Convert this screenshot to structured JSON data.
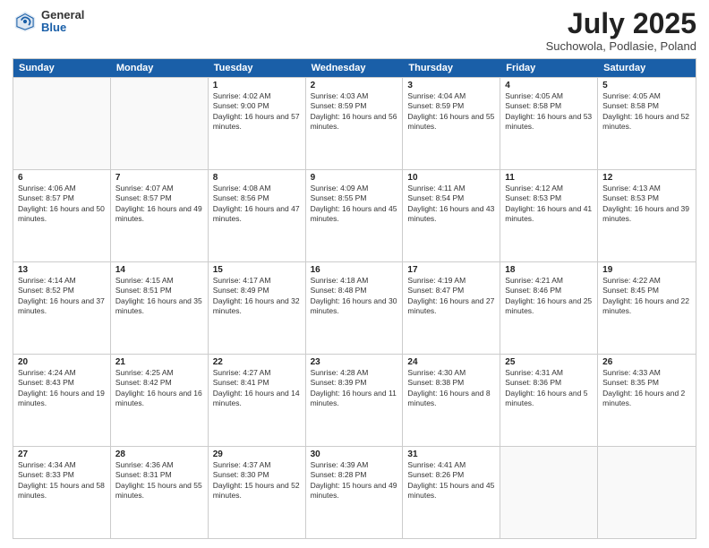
{
  "logo": {
    "general": "General",
    "blue": "Blue"
  },
  "header": {
    "month_year": "July 2025",
    "location": "Suchowola, Podlasie, Poland"
  },
  "days_of_week": [
    "Sunday",
    "Monday",
    "Tuesday",
    "Wednesday",
    "Thursday",
    "Friday",
    "Saturday"
  ],
  "weeks": [
    [
      {
        "day": "",
        "empty": true
      },
      {
        "day": "",
        "empty": true
      },
      {
        "day": "1",
        "rise": "4:02 AM",
        "set": "9:00 PM",
        "daylight": "16 hours and 57 minutes."
      },
      {
        "day": "2",
        "rise": "4:03 AM",
        "set": "8:59 PM",
        "daylight": "16 hours and 56 minutes."
      },
      {
        "day": "3",
        "rise": "4:04 AM",
        "set": "8:59 PM",
        "daylight": "16 hours and 55 minutes."
      },
      {
        "day": "4",
        "rise": "4:05 AM",
        "set": "8:58 PM",
        "daylight": "16 hours and 53 minutes."
      },
      {
        "day": "5",
        "rise": "4:05 AM",
        "set": "8:58 PM",
        "daylight": "16 hours and 52 minutes."
      }
    ],
    [
      {
        "day": "6",
        "rise": "4:06 AM",
        "set": "8:57 PM",
        "daylight": "16 hours and 50 minutes."
      },
      {
        "day": "7",
        "rise": "4:07 AM",
        "set": "8:57 PM",
        "daylight": "16 hours and 49 minutes."
      },
      {
        "day": "8",
        "rise": "4:08 AM",
        "set": "8:56 PM",
        "daylight": "16 hours and 47 minutes."
      },
      {
        "day": "9",
        "rise": "4:09 AM",
        "set": "8:55 PM",
        "daylight": "16 hours and 45 minutes."
      },
      {
        "day": "10",
        "rise": "4:11 AM",
        "set": "8:54 PM",
        "daylight": "16 hours and 43 minutes."
      },
      {
        "day": "11",
        "rise": "4:12 AM",
        "set": "8:53 PM",
        "daylight": "16 hours and 41 minutes."
      },
      {
        "day": "12",
        "rise": "4:13 AM",
        "set": "8:53 PM",
        "daylight": "16 hours and 39 minutes."
      }
    ],
    [
      {
        "day": "13",
        "rise": "4:14 AM",
        "set": "8:52 PM",
        "daylight": "16 hours and 37 minutes."
      },
      {
        "day": "14",
        "rise": "4:15 AM",
        "set": "8:51 PM",
        "daylight": "16 hours and 35 minutes."
      },
      {
        "day": "15",
        "rise": "4:17 AM",
        "set": "8:49 PM",
        "daylight": "16 hours and 32 minutes."
      },
      {
        "day": "16",
        "rise": "4:18 AM",
        "set": "8:48 PM",
        "daylight": "16 hours and 30 minutes."
      },
      {
        "day": "17",
        "rise": "4:19 AM",
        "set": "8:47 PM",
        "daylight": "16 hours and 27 minutes."
      },
      {
        "day": "18",
        "rise": "4:21 AM",
        "set": "8:46 PM",
        "daylight": "16 hours and 25 minutes."
      },
      {
        "day": "19",
        "rise": "4:22 AM",
        "set": "8:45 PM",
        "daylight": "16 hours and 22 minutes."
      }
    ],
    [
      {
        "day": "20",
        "rise": "4:24 AM",
        "set": "8:43 PM",
        "daylight": "16 hours and 19 minutes."
      },
      {
        "day": "21",
        "rise": "4:25 AM",
        "set": "8:42 PM",
        "daylight": "16 hours and 16 minutes."
      },
      {
        "day": "22",
        "rise": "4:27 AM",
        "set": "8:41 PM",
        "daylight": "16 hours and 14 minutes."
      },
      {
        "day": "23",
        "rise": "4:28 AM",
        "set": "8:39 PM",
        "daylight": "16 hours and 11 minutes."
      },
      {
        "day": "24",
        "rise": "4:30 AM",
        "set": "8:38 PM",
        "daylight": "16 hours and 8 minutes."
      },
      {
        "day": "25",
        "rise": "4:31 AM",
        "set": "8:36 PM",
        "daylight": "16 hours and 5 minutes."
      },
      {
        "day": "26",
        "rise": "4:33 AM",
        "set": "8:35 PM",
        "daylight": "16 hours and 2 minutes."
      }
    ],
    [
      {
        "day": "27",
        "rise": "4:34 AM",
        "set": "8:33 PM",
        "daylight": "15 hours and 58 minutes."
      },
      {
        "day": "28",
        "rise": "4:36 AM",
        "set": "8:31 PM",
        "daylight": "15 hours and 55 minutes."
      },
      {
        "day": "29",
        "rise": "4:37 AM",
        "set": "8:30 PM",
        "daylight": "15 hours and 52 minutes."
      },
      {
        "day": "30",
        "rise": "4:39 AM",
        "set": "8:28 PM",
        "daylight": "15 hours and 49 minutes."
      },
      {
        "day": "31",
        "rise": "4:41 AM",
        "set": "8:26 PM",
        "daylight": "15 hours and 45 minutes."
      },
      {
        "day": "",
        "empty": true
      },
      {
        "day": "",
        "empty": true
      }
    ]
  ]
}
